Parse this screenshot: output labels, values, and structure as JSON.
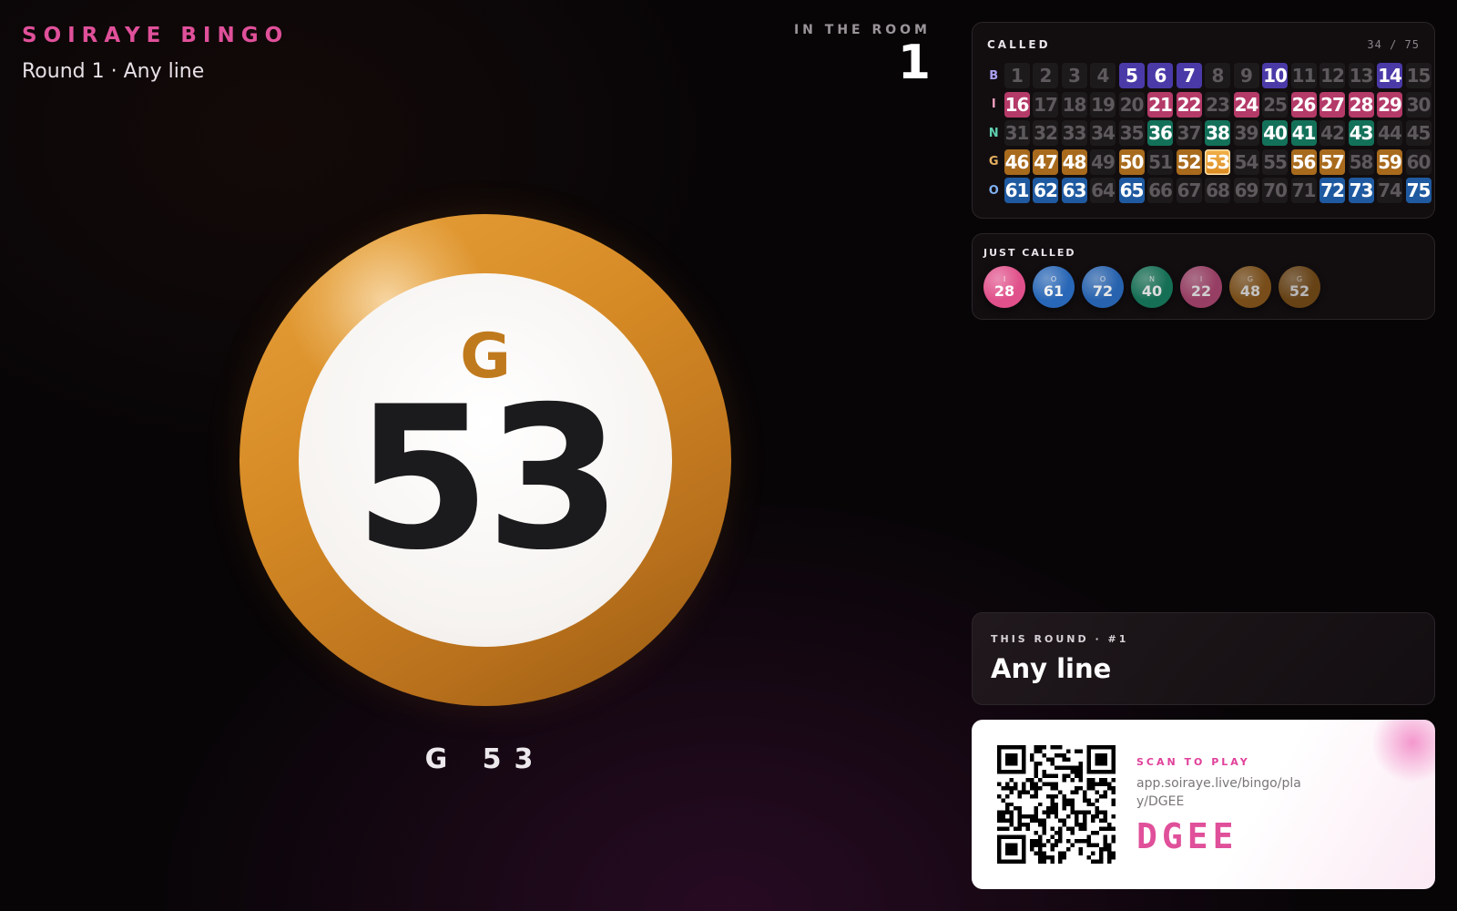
{
  "header": {
    "brand": "SOIRAYE BINGO",
    "subtitle": "Round 1 · Any line"
  },
  "room": {
    "label": "IN THE ROOM",
    "count": "1"
  },
  "current_call": {
    "letter": "G",
    "number": "53",
    "caption": "G 53"
  },
  "called_board": {
    "label": "CALLED",
    "count_text": "34 / 75",
    "current": 53,
    "rows": [
      {
        "letter": "B",
        "color": "#4a3aa8",
        "letter_color": "#a9a0f0",
        "start": 1,
        "called": [
          5,
          6,
          7,
          10,
          14
        ]
      },
      {
        "letter": "I",
        "color": "#b43a68",
        "letter_color": "#f0a0c0",
        "start": 16,
        "called": [
          16,
          21,
          22,
          24,
          26,
          27,
          28,
          29
        ]
      },
      {
        "letter": "N",
        "color": "#13715a",
        "letter_color": "#5fd0b0",
        "start": 31,
        "called": [
          36,
          38,
          40,
          41,
          43
        ]
      },
      {
        "letter": "G",
        "color": "#a86a1c",
        "letter_color": "#e8b060",
        "start": 46,
        "called": [
          46,
          47,
          48,
          50,
          52,
          53,
          56,
          57,
          59
        ]
      },
      {
        "letter": "O",
        "color": "#1f5aa0",
        "letter_color": "#80b0f0",
        "start": 61,
        "called": [
          61,
          62,
          63,
          65,
          72,
          73,
          75
        ]
      }
    ]
  },
  "just_called": {
    "label": "JUST CALLED",
    "balls": [
      {
        "letter": "I",
        "number": "28",
        "color": "#e0508a",
        "opacity": 1.0
      },
      {
        "letter": "O",
        "number": "61",
        "color": "#2a6cc0",
        "opacity": 0.95
      },
      {
        "letter": "O",
        "number": "72",
        "color": "#2a6cc0",
        "opacity": 0.9
      },
      {
        "letter": "N",
        "number": "40",
        "color": "#168060",
        "opacity": 0.85
      },
      {
        "letter": "I",
        "number": "22",
        "color": "#b84a78",
        "opacity": 0.8
      },
      {
        "letter": "G",
        "number": "48",
        "color": "#9a621c",
        "opacity": 0.75
      },
      {
        "letter": "G",
        "number": "52",
        "color": "#8a5818",
        "opacity": 0.7
      }
    ]
  },
  "round": {
    "label": "THIS ROUND · #1",
    "name": "Any line"
  },
  "join": {
    "label": "SCAN TO PLAY",
    "url": "app.soiraye.live/bingo/play/DGEE",
    "code": "DGEE",
    "qr_icon": "qr-code-icon"
  }
}
